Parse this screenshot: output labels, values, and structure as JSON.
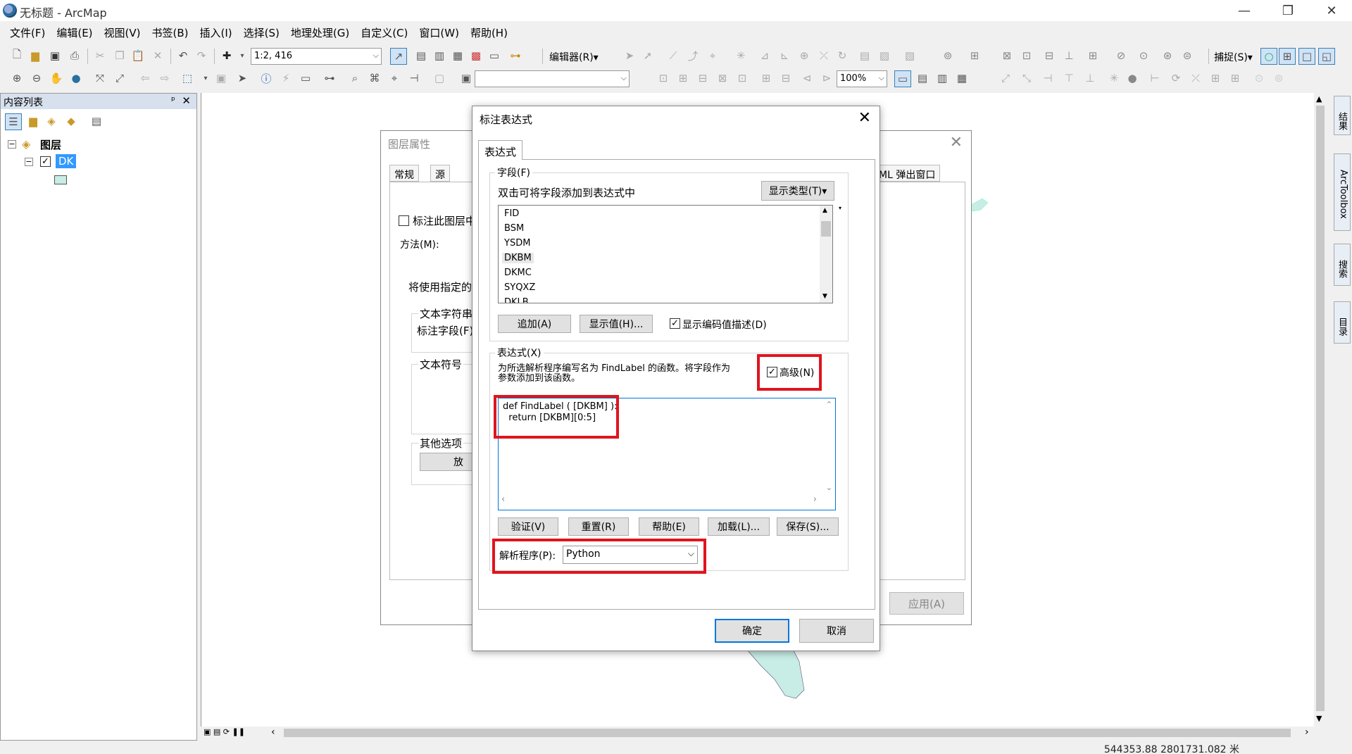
{
  "app": {
    "title": "无标题 - ArcMap",
    "window_controls": [
      "—",
      "❐",
      "✕"
    ]
  },
  "menu": [
    "文件(F)",
    "编辑(E)",
    "视图(V)",
    "书签(B)",
    "插入(I)",
    "选择(S)",
    "地理处理(G)",
    "自定义(C)",
    "窗口(W)",
    "帮助(H)"
  ],
  "toolbar": {
    "scale_value": "1:2, 416",
    "editor_label": "编辑器(R)▾",
    "snapping_label": "捕捉(S)▾",
    "zoom_value": "100%"
  },
  "toc": {
    "title": "内容列表",
    "pin": "ᵖ",
    "close": "✕",
    "root_label": "图层",
    "layer_name": "DK"
  },
  "side_tabs": [
    "结果",
    "ArcToolbox",
    "搜索",
    "目录"
  ],
  "status": {
    "coords": "544353.88  2801731.082 米"
  },
  "layer_properties": {
    "title": "图层属性",
    "tabs": [
      "常规",
      "源"
    ],
    "tab_right": "ML 弹出窗口",
    "label_checkbox": "标注此图层中",
    "method_label": "方法(M):",
    "use_specified": "将使用指定的",
    "text_string": "文本字符串",
    "label_field": "标注字段(F):",
    "text_symbol": "文本符号",
    "other_options": "其他选项",
    "place_button": "放",
    "apply_button": "应用(A)"
  },
  "dialog": {
    "title": "标注表达式",
    "tab": "表达式",
    "fields_group": "字段(F)",
    "fields_hint": "双击可将字段添加到表达式中",
    "show_type_button": "显示类型(T)▾",
    "fields": [
      "FID",
      "BSM",
      "YSDM",
      "DKBM",
      "DKMC",
      "SYQXZ",
      "DKLB"
    ],
    "selected_field": "DKBM",
    "append_button": "追加(A)",
    "show_values_button": "显示值(H)...",
    "show_coded_checkbox": "显示编码值描述(D)",
    "expression_group": "表达式(X)",
    "expression_hint_line1": "为所选解析程序编写名为 FindLabel 的函数。将字段作为",
    "expression_hint_line2": "参数添加到该函数。",
    "advanced_checkbox": "高级(N)",
    "code_line1": "def FindLabel ( [DKBM] ):",
    "code_line2": "  return [DKBM][0:5]",
    "verify_button": "验证(V)",
    "reset_button": "重置(R)",
    "help_button": "帮助(E)",
    "load_button": "加载(L)...",
    "save_button": "保存(S)...",
    "parser_label": "解析程序(P):",
    "parser_value": "Python",
    "ok_button": "确定",
    "cancel_button": "取消"
  },
  "colors": {
    "highlight_red": "#e0141e",
    "focus_blue": "#0078d7",
    "map_feature": "#c8ece6"
  }
}
